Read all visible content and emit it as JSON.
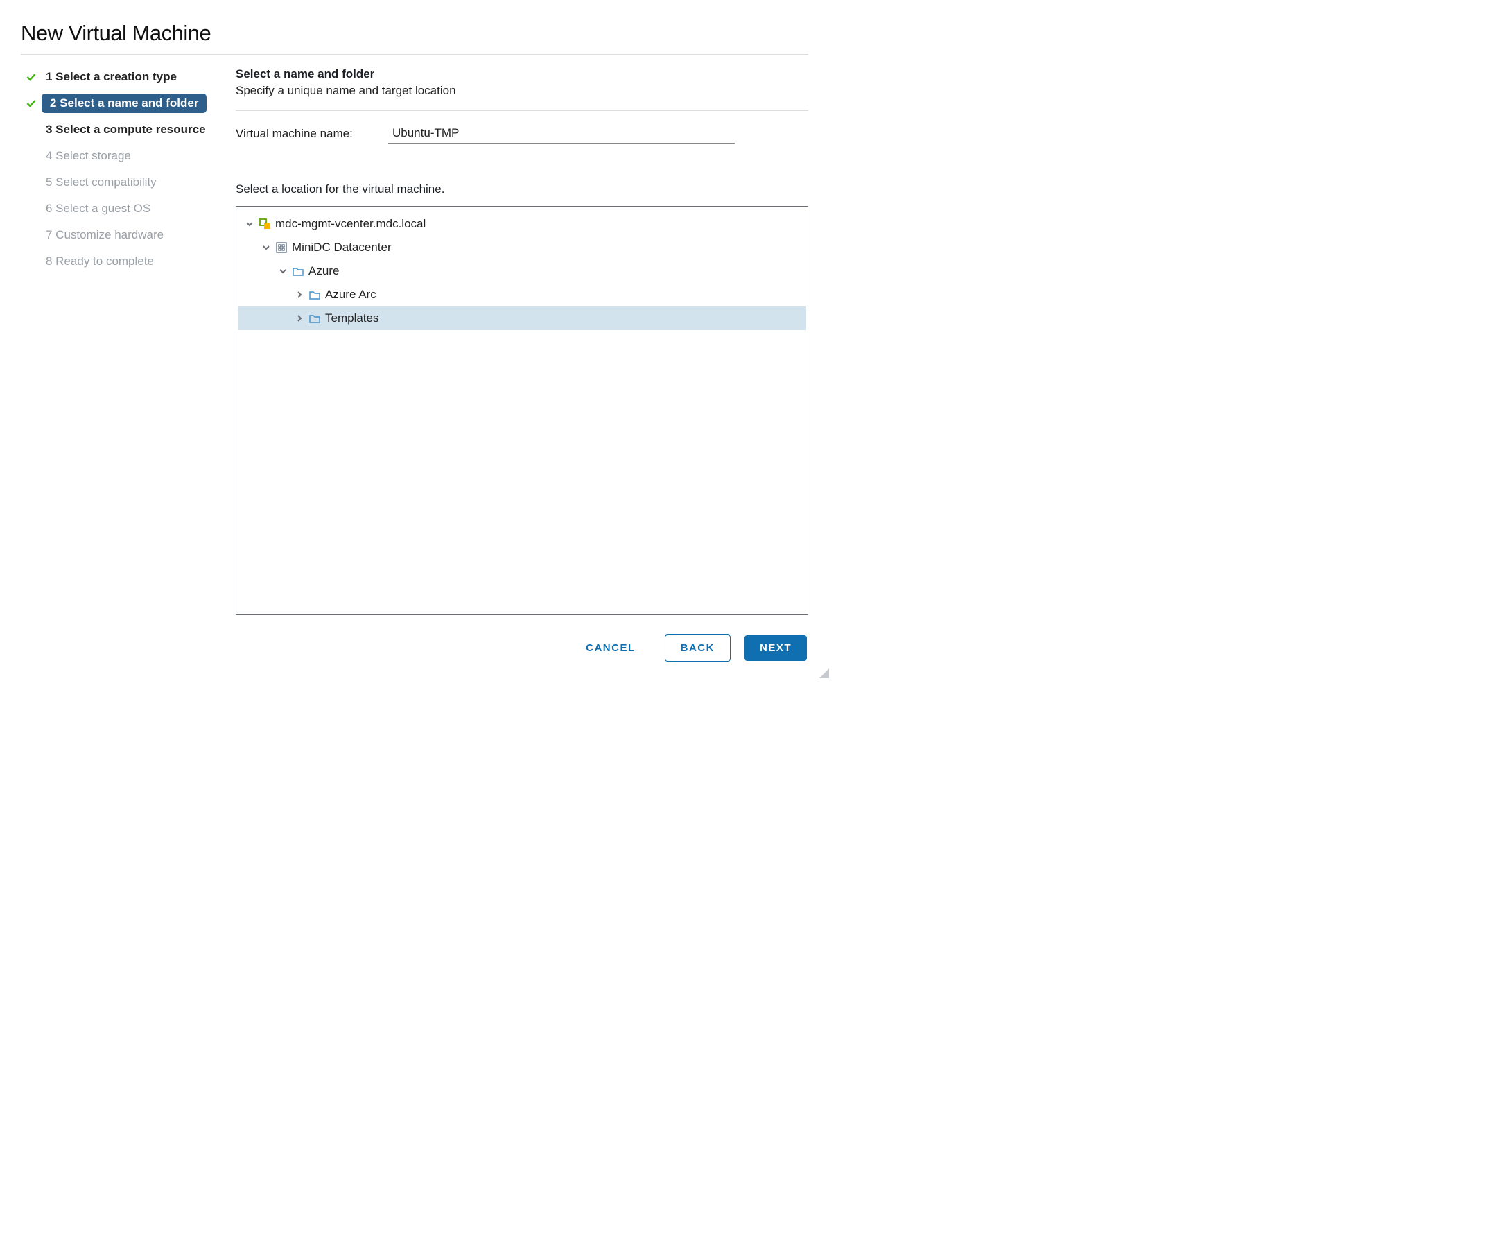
{
  "dialog": {
    "title": "New Virtual Machine"
  },
  "steps": [
    {
      "num": "1",
      "label": "Select a creation type",
      "state": "done"
    },
    {
      "num": "2",
      "label": "Select a name and folder",
      "state": "current"
    },
    {
      "num": "3",
      "label": "Select a compute resource",
      "state": "enabled"
    },
    {
      "num": "4",
      "label": "Select storage",
      "state": "disabled"
    },
    {
      "num": "5",
      "label": "Select compatibility",
      "state": "disabled"
    },
    {
      "num": "6",
      "label": "Select a guest OS",
      "state": "disabled"
    },
    {
      "num": "7",
      "label": "Customize hardware",
      "state": "disabled"
    },
    {
      "num": "8",
      "label": "Ready to complete",
      "state": "disabled"
    }
  ],
  "main": {
    "section_title": "Select a name and folder",
    "section_subtitle": "Specify a unique name and target location",
    "vm_name_label": "Virtual machine name:",
    "vm_name_value": "Ubuntu-TMP",
    "location_label": "Select a location for the virtual machine."
  },
  "tree": [
    {
      "label": "mdc-mgmt-vcenter.mdc.local",
      "icon": "vcenter",
      "indent": 0,
      "twisty": "down",
      "selected": false
    },
    {
      "label": "MiniDC Datacenter",
      "icon": "datacenter",
      "indent": 1,
      "twisty": "down",
      "selected": false
    },
    {
      "label": "Azure",
      "icon": "folder",
      "indent": 2,
      "twisty": "down",
      "selected": false
    },
    {
      "label": "Azure Arc",
      "icon": "folder",
      "indent": 3,
      "twisty": "right",
      "selected": false
    },
    {
      "label": "Templates",
      "icon": "folder",
      "indent": 3,
      "twisty": "right",
      "selected": true
    }
  ],
  "footer": {
    "cancel": "Cancel",
    "back": "Back",
    "next": "Next"
  }
}
